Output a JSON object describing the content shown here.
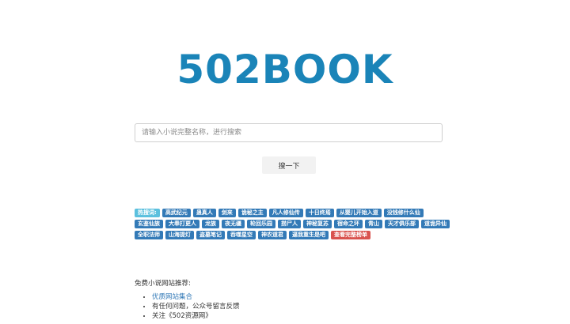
{
  "logo": {
    "text": "502BOOK",
    "color": "#1a84b8"
  },
  "search": {
    "placeholder": "请输入小说完整名称，进行搜索",
    "button_label": "搜一下"
  },
  "hot_search": {
    "label": "热搜词:",
    "tags": [
      "高武纪元",
      "蛊真人",
      "剑来",
      "诡秘之主",
      "凡人修仙传",
      "十日终焉",
      "从婴儿开始入道",
      "没钱修什么仙",
      "玄鉴仙族",
      "大奉打更人",
      "龙族",
      "夜无疆",
      "轮回乐园",
      "捞尸人",
      "神秘复苏",
      "宿命之环",
      "青山",
      "天才俱乐部",
      "道诡异仙",
      "全职法师",
      "山海提灯",
      "盗墓笔记",
      "吞噬星空",
      "神农道君",
      "逼我重生是吧"
    ],
    "view_all_label": "查看完整榜单",
    "tag_color": "#337ab7",
    "label_color": "#5bc0de",
    "view_all_color": "#d9534f"
  },
  "recommend": {
    "title": "免费小说网站推荐:",
    "items": [
      {
        "text": "优质网站集合",
        "link": true
      },
      {
        "text": "有任何问题，公众号留言反馈",
        "link": false
      },
      {
        "text": "关注《502资源网》",
        "link": false
      }
    ]
  }
}
